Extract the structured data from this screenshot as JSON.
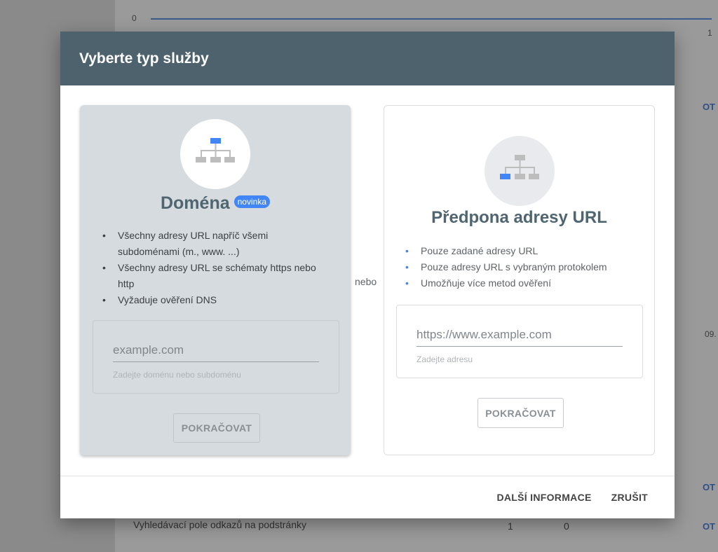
{
  "background": {
    "axis_zero": "0",
    "right_labels": [
      "OT",
      "OT",
      "OT"
    ],
    "axis_small_1": "1",
    "date_label": "09.",
    "row_text": "Vyhledávací pole odkazů na podstránky",
    "row_values": [
      "1",
      "0"
    ]
  },
  "dialog": {
    "title": "Vyberte typ služby",
    "separator": "nebo",
    "domain": {
      "title": "Doména",
      "badge": "novinka",
      "bullets": [
        "Všechny adresy URL napříč všemi subdoménami (m., www. ...)",
        "Všechny adresy URL se schématy https nebo http",
        "Vyžaduje ověření DNS"
      ],
      "input_placeholder": "example.com",
      "helper": "Zadejte doménu nebo subdoménu",
      "button": "POKRAČOVAT"
    },
    "url_prefix": {
      "title": "Předpona adresy URL",
      "bullets": [
        "Pouze zadané adresy URL",
        "Pouze adresy URL s vybraným protokolem",
        "Umožňuje více metod ověření"
      ],
      "input_placeholder": "https://www.example.com",
      "helper": "Zadejte adresu",
      "button": "POKRAČOVAT"
    },
    "footer": {
      "more_info": "DALŠÍ INFORMACE",
      "cancel": "ZRUŠIT"
    }
  },
  "colors": {
    "header_bg": "#4d626d",
    "accent_blue": "#4285f4",
    "domain_card_bg": "#d5dbde"
  }
}
